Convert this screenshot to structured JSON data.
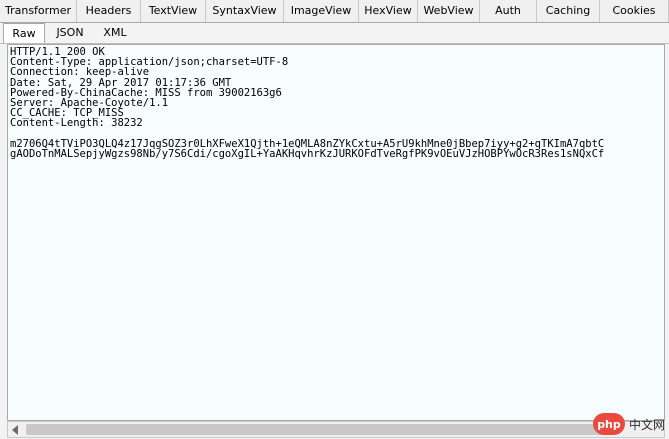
{
  "top_tabs": [
    "Transformer",
    "Headers",
    "TextView",
    "SyntaxView",
    "ImageView",
    "HexView",
    "WebView",
    "Auth",
    "Caching",
    "Cookies"
  ],
  "sub_tabs": [
    "Raw",
    "JSON",
    "XML"
  ],
  "active_sub_tab": "Raw",
  "response_text": "HTTP/1.1 200 OK\nContent-Type: application/json;charset=UTF-8\nConnection: keep-alive\nDate: Sat, 29 Apr 2017 01:17:36 GMT\nPowered-By-ChinaCache: MISS from 39002163g6\nServer: Apache-Coyote/1.1\nCC_CACHE: TCP_MISS\nContent-Length: 38232\n\nm2706Q4tTViPO3QLQ4z17JqgSOZ3r0LhXFweX1Qjth+1eQMLA8nZYkCxtu+A5rU9khMne0jBbep7iyy+g2+qTKImA7qbtC\ngAODoTnMALSepjyWgzs98Nb/y7S6Cdi/cgoXgIL+YaAKHqvhrKzJURKOFdTveRgfPK9vOEuVJzHOBPYwOcR3Res1sNQxCf",
  "watermark": {
    "logo": "php",
    "text": "中文网"
  }
}
